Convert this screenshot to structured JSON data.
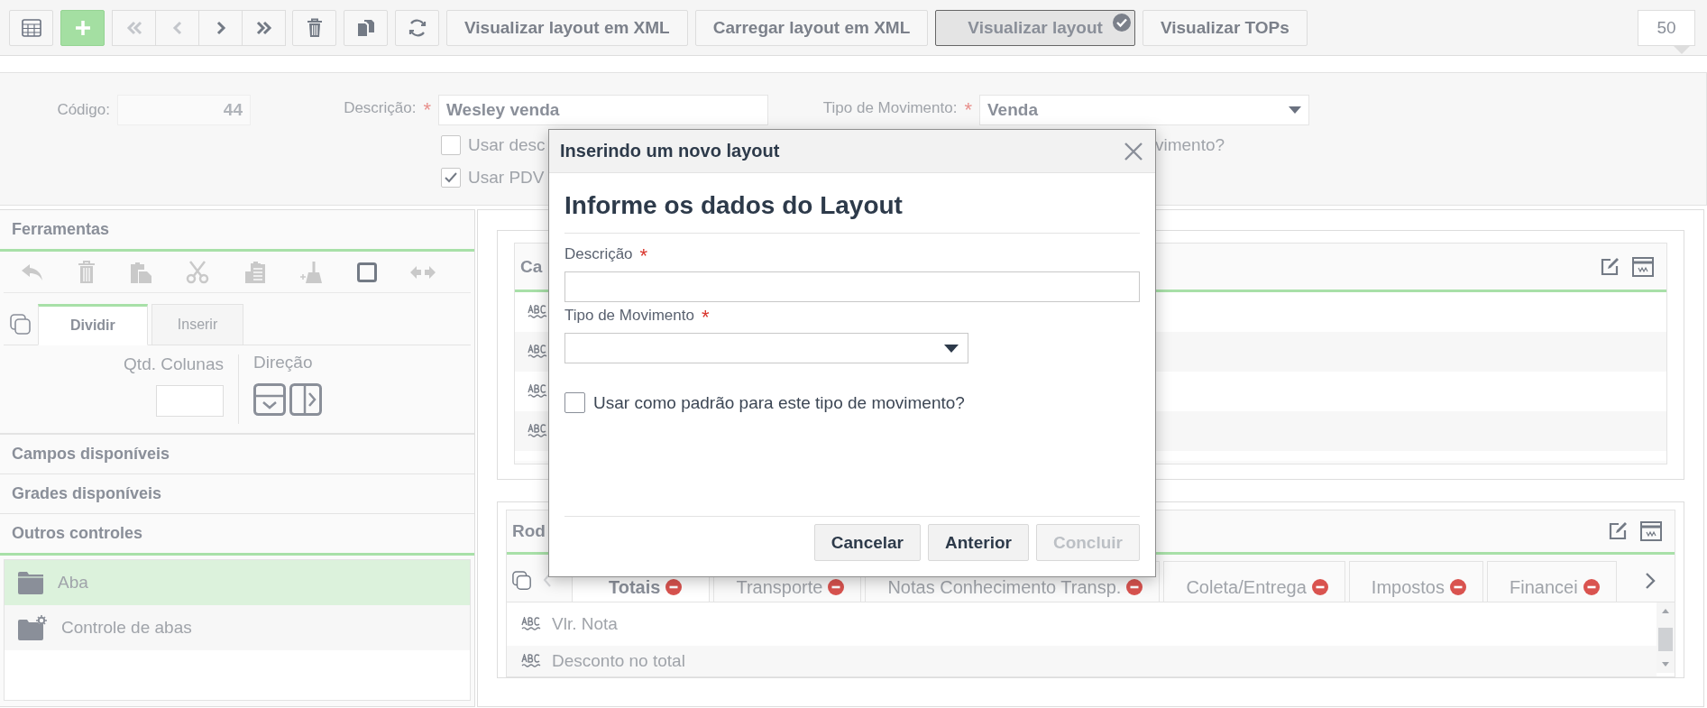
{
  "toolbar": {
    "nav_buttons": [
      {
        "kind": "first",
        "disabled": true
      },
      {
        "kind": "previous",
        "disabled": true
      },
      {
        "kind": "next",
        "disabled": false
      },
      {
        "kind": "last",
        "disabled": false
      }
    ],
    "text_buttons": [
      {
        "label": "Visualizar layout em XML",
        "selected": false
      },
      {
        "label": "Carregar layout em XML",
        "selected": false
      },
      {
        "label": "Visualizar layout",
        "selected": true
      },
      {
        "label": "Visualizar TOPs",
        "selected": false
      }
    ],
    "page_size": "50"
  },
  "form": {
    "fields": [
      {
        "label": "Código:",
        "value": "44"
      },
      {
        "label": "Descrição:",
        "required_mark": "*",
        "value": "Wesley venda",
        "kind": "text"
      },
      {
        "label": "Tipo de Movimento:",
        "required_mark": "*",
        "value": "Venda",
        "kind": "select"
      }
    ],
    "checkboxes": [
      {
        "label": "Usar desc",
        "checked": false,
        "tail": "vimento?"
      },
      {
        "label": "Usar PDV",
        "checked": true
      }
    ]
  },
  "sidebar": {
    "title": "Ferramentas",
    "tabs": [
      {
        "label": "Dividir",
        "selected": true
      },
      {
        "label": "Inserir",
        "selected": false
      }
    ],
    "columns_label": "Qtd. Colunas",
    "direction_label": "Direção",
    "sections": [
      {
        "label": "Campos disponíveis",
        "expanded": false
      },
      {
        "label": "Grades disponíveis",
        "expanded": false
      },
      {
        "label": "Outros controles",
        "expanded": true
      }
    ],
    "controls": [
      {
        "label": "Aba",
        "selected": true,
        "kind": "folder"
      },
      {
        "label": "Controle de abas",
        "selected": false,
        "kind": "folder-settings"
      }
    ]
  },
  "header_panel": {
    "title": "Ca"
  },
  "footer_panel": {
    "title": "Rod",
    "tabs": [
      {
        "label": "Totais",
        "selected": true
      },
      {
        "label": "Transporte",
        "selected": false
      },
      {
        "label": "Notas Conhecimento Transp.",
        "selected": false
      },
      {
        "label": "Coleta/Entrega",
        "selected": false
      },
      {
        "label": "Impostos",
        "selected": false
      },
      {
        "label": "Financei",
        "selected": false
      }
    ],
    "rows": [
      {
        "label": "Vlr. Nota"
      },
      {
        "label": "Desconto no total"
      }
    ]
  },
  "dialog": {
    "title": "Inserindo um novo layout",
    "heading": "Informe os dados do Layout",
    "fields": [
      {
        "label": "Descrição",
        "required_mark": "*",
        "kind": "text"
      },
      {
        "label": "Tipo de Movimento",
        "required_mark": "*",
        "kind": "select"
      }
    ],
    "checkbox": {
      "label": "Usar como padrão para este tipo de movimento?",
      "checked": false
    },
    "buttons": [
      {
        "label": "Cancelar",
        "disabled": false
      },
      {
        "label": "Anterior",
        "disabled": false
      },
      {
        "label": "Concluir",
        "disabled": true
      }
    ]
  }
}
